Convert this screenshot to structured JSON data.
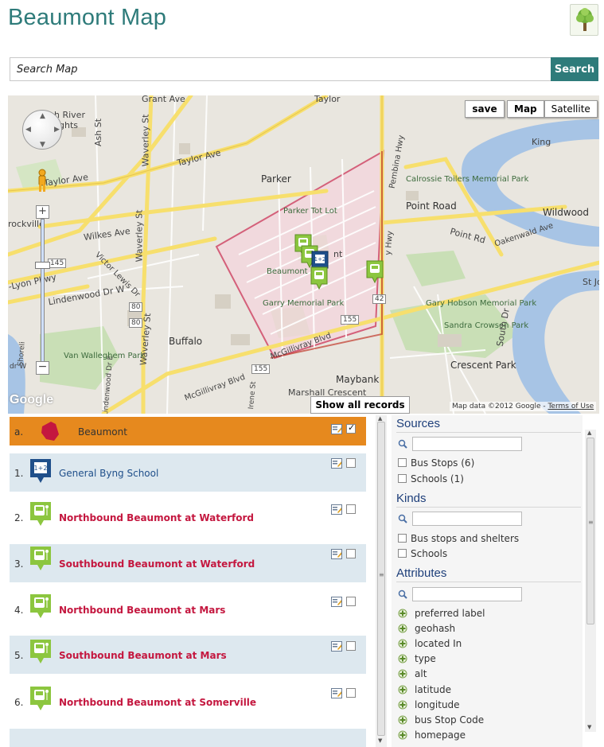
{
  "app": {
    "title": "Beaumont Map"
  },
  "search": {
    "placeholder": "Search Map",
    "button_label": "Search"
  },
  "map": {
    "save_label": "save",
    "map_type_map": "Map",
    "map_type_satellite": "Satellite",
    "show_all_label": "Show all records",
    "google_logo": "Google",
    "attribution_prefix": "Map data ©2012 Google - ",
    "attribution_link": "Terms of Use",
    "labels": {
      "grant_ave": "Grant Ave",
      "taylor_top": "Taylor",
      "north_river": "h River",
      "heights": "ghts",
      "ash_st": "Ash St",
      "waverley_st_north": "Waverley St",
      "taylor_ave_1": "Taylor Ave",
      "taylor_ave_2": "Taylor Ave",
      "parker": "Parker",
      "parker_tot_lot": "Parker Tot Lot",
      "calrossie": "Calrossie Toilers Memorial Park",
      "point_road": "Point Road",
      "wildwood": "Wildwood",
      "pembina_hwy": "Pembina Hwy",
      "point_rd": "Point Rd",
      "oakenwald_ave": "Oakenwald Ave",
      "rockville": "rockville",
      "wilkes_ave": "Wilkes Ave",
      "waverley_st_mid": "Waverley St",
      "victor_lewis": "Victor Lewis Dr",
      "lyon_pkwy": "-Lyon Pkwy",
      "lindenwood": "Lindenwood Dr W",
      "beaumont_park": "Beaumont Park",
      "garry_memorial": "Garry Memorial Park",
      "gary_hobson": "Gary Hobson Memorial Park",
      "sandra_crowson": "Sandra Crowson Park",
      "south_dr": "South Dr",
      "st_jo": "St Jo",
      "king": "King",
      "buffalo": "Buffalo",
      "van_walleghem": "Van Walleghem Park",
      "waverley_st_low": "Waverley St",
      "mcgillivray_1": "McGillivray Blvd",
      "mcgillivray_2": "McGillivray Blvd",
      "maybank": "Maybank",
      "crescent_park": "Crescent Park",
      "marshall": "Marshall Crescent",
      "irene_st": "Irene St",
      "shoreline": "Shoreli",
      "dr_w": "dr W",
      "lindenwood_dr_e": "Lindenwood Dr E",
      "hwy_145": "145",
      "hwy_80a": "80",
      "hwy_80b": "80",
      "hwy_42": "42",
      "hwy_155a": "155",
      "hwy_155b": "155",
      "nt": "nt",
      "y_hwy": "y Hwy"
    }
  },
  "results": [
    {
      "index": "a.",
      "label": "Beaumont",
      "type": "region",
      "checked": true
    },
    {
      "index": "1.",
      "label": "General Byng School",
      "type": "school",
      "checked": false
    },
    {
      "index": "2.",
      "label": "Northbound Beaumont at Waterford",
      "type": "bus",
      "checked": false
    },
    {
      "index": "3.",
      "label": "Southbound Beaumont at Waterford",
      "type": "bus",
      "checked": false
    },
    {
      "index": "4.",
      "label": "Northbound Beaumont at Mars",
      "type": "bus",
      "checked": false
    },
    {
      "index": "5.",
      "label": "Southbound Beaumont at Mars",
      "type": "bus",
      "checked": false
    },
    {
      "index": "6.",
      "label": "Northbound Beaumont at Somerville",
      "type": "bus",
      "checked": false
    }
  ],
  "facets": {
    "sources": {
      "title": "Sources",
      "options": [
        "Bus Stops (6)",
        "Schools (1)"
      ]
    },
    "kinds": {
      "title": "Kinds",
      "options": [
        "Bus stops and shelters",
        "Schools"
      ]
    },
    "attributes": {
      "title": "Attributes",
      "items": [
        "preferred label",
        "geohash",
        "located In",
        "type",
        "alt",
        "latitude",
        "longitude",
        "bus Stop Code",
        "homepage"
      ]
    }
  },
  "colors": {
    "title_teal": "#2e7b7a",
    "selected_row": "#e6891e",
    "alt_row": "#dde8ef",
    "bus_label": "#c4173f",
    "school_label": "#1f4f8a",
    "facet_title": "#1e3f7a",
    "bus_marker": "#8cc63f",
    "school_marker": "#1f4f8a",
    "region_outline": "#d4607a"
  }
}
